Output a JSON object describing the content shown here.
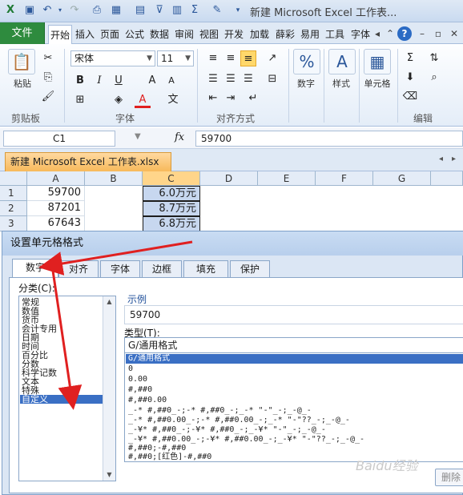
{
  "window": {
    "title": "新建 Microsoft Excel 工作表..."
  },
  "ribbon_tabs": [
    "开始",
    "插入",
    "页面",
    "公式",
    "数据",
    "审阅",
    "视图",
    "开发",
    "加载",
    "薛彩",
    "易用",
    "工具",
    "字体"
  ],
  "file_tab": "文件",
  "ribbon": {
    "clipboard": {
      "paste": "粘贴",
      "group": "剪贴板"
    },
    "font": {
      "name": "宋体",
      "size": "11",
      "bold": "B",
      "italic": "I",
      "underline": "U",
      "group": "字体"
    },
    "alignment": {
      "group": "对齐方式"
    },
    "number": {
      "label": "数字"
    },
    "styles": {
      "label": "样式"
    },
    "cells": {
      "label": "单元格"
    },
    "editing": {
      "group": "编辑"
    }
  },
  "formula_bar": {
    "name_box": "C1",
    "fx": "fx",
    "value": "59700"
  },
  "workbook_tab": "新建 Microsoft Excel 工作表.xlsx",
  "grid": {
    "columns": [
      "A",
      "B",
      "C",
      "D",
      "E",
      "F",
      "G"
    ],
    "rows": [
      {
        "num": "1",
        "a": "59700",
        "c": "6.0万元"
      },
      {
        "num": "2",
        "a": "87201",
        "c": "8.7万元"
      },
      {
        "num": "3",
        "a": "67643",
        "c": "6.8万元"
      }
    ]
  },
  "dialog": {
    "title": "设置单元格格式",
    "tabs": [
      "数字",
      "对齐",
      "字体",
      "边框",
      "填充",
      "保护"
    ],
    "category_label": "分类(C):",
    "categories": [
      "常规",
      "数值",
      "货币",
      "会计专用",
      "日期",
      "时间",
      "百分比",
      "分数",
      "科学记数",
      "文本",
      "特殊",
      "自定义"
    ],
    "selected_category": "自定义",
    "sample_label": "示例",
    "sample_value": "59700",
    "type_label": "类型(T):",
    "type_value": "G/通用格式",
    "type_list": [
      "G/通用格式",
      "0",
      "0.00",
      "#,##0",
      "#,##0.00",
      "_-* #,##0_-;-* #,##0_-;_-* \"-\"_-;_-@_-",
      "_-* #,##0.00_-;-* #,##0.00_-;_-* \"-\"??_-;_-@_-",
      "_-¥* #,##0_-;-¥* #,##0_-;_-¥* \"-\"_-;_-@_-",
      "_-¥* #,##0.00_-;-¥* #,##0.00_-;_-¥* \"-\"??_-;_-@_-",
      "#,##0;-#,##0",
      "#,##0;[红色]-#,##0"
    ],
    "delete_button": "删除"
  },
  "watermark": "Baidu经验",
  "colors": {
    "file_tab": "#2e8b3e",
    "selection": "#3a6fc4",
    "arrow": "#e02020",
    "workbook_tab": "#f7b95a"
  }
}
